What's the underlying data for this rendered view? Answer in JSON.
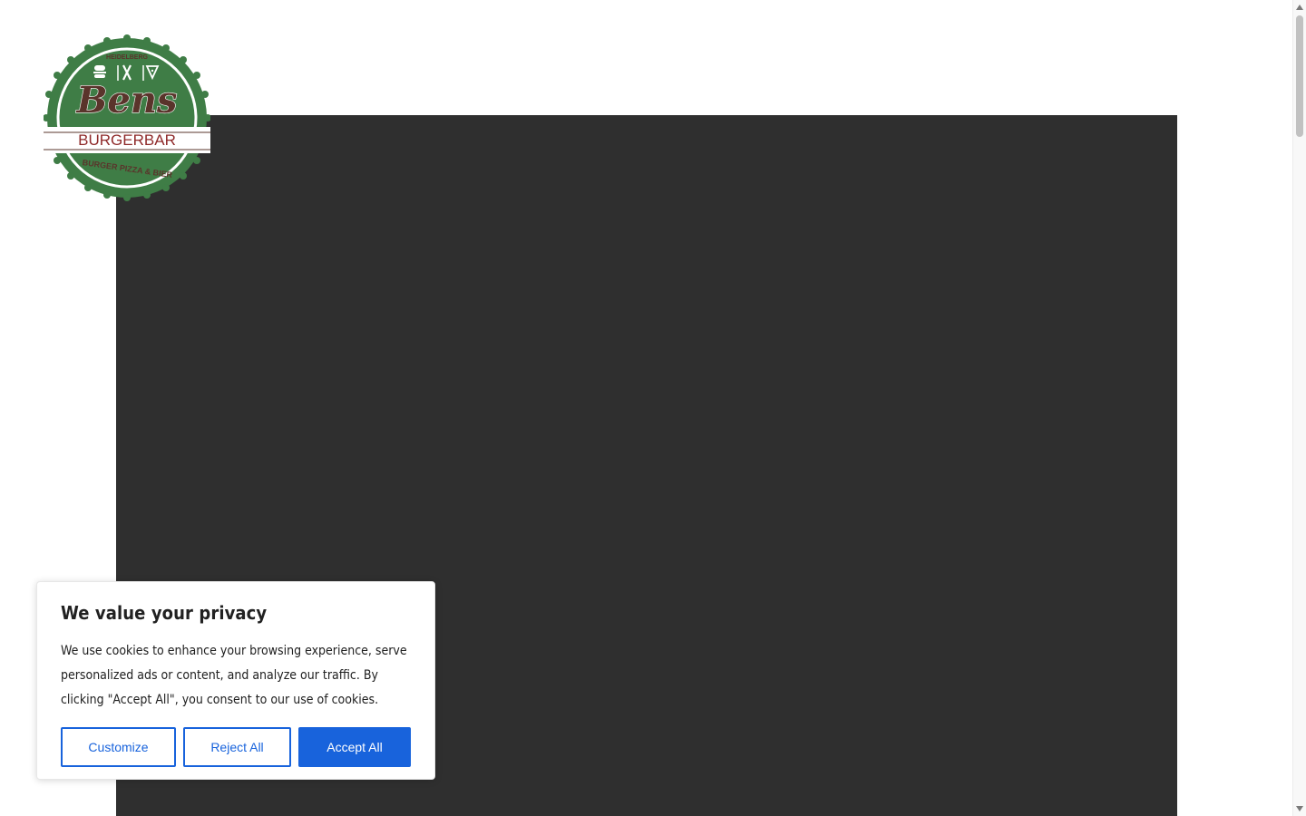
{
  "site": {
    "logo": {
      "top_text": "HEIDELBERG",
      "brand": "Bens",
      "subtitle": "BURGERBAR",
      "bottom_text": "BURGER PIZZA & BIER",
      "colors": {
        "green": "#3f7d46",
        "cream": "#ffffff",
        "brown": "#5a342b",
        "red": "#8f2a2a"
      }
    }
  },
  "hero": {
    "background": "#2f2f2f"
  },
  "cookie_banner": {
    "title": "We value your privacy",
    "text": "We use cookies to enhance your browsing experience, serve personalized ads or content, and analyze our traffic. By clicking \"Accept All\", you consent to our use of cookies.",
    "buttons": {
      "customize": "Customize",
      "reject": "Reject All",
      "accept": "Accept All"
    },
    "accent": "#1863dc"
  }
}
